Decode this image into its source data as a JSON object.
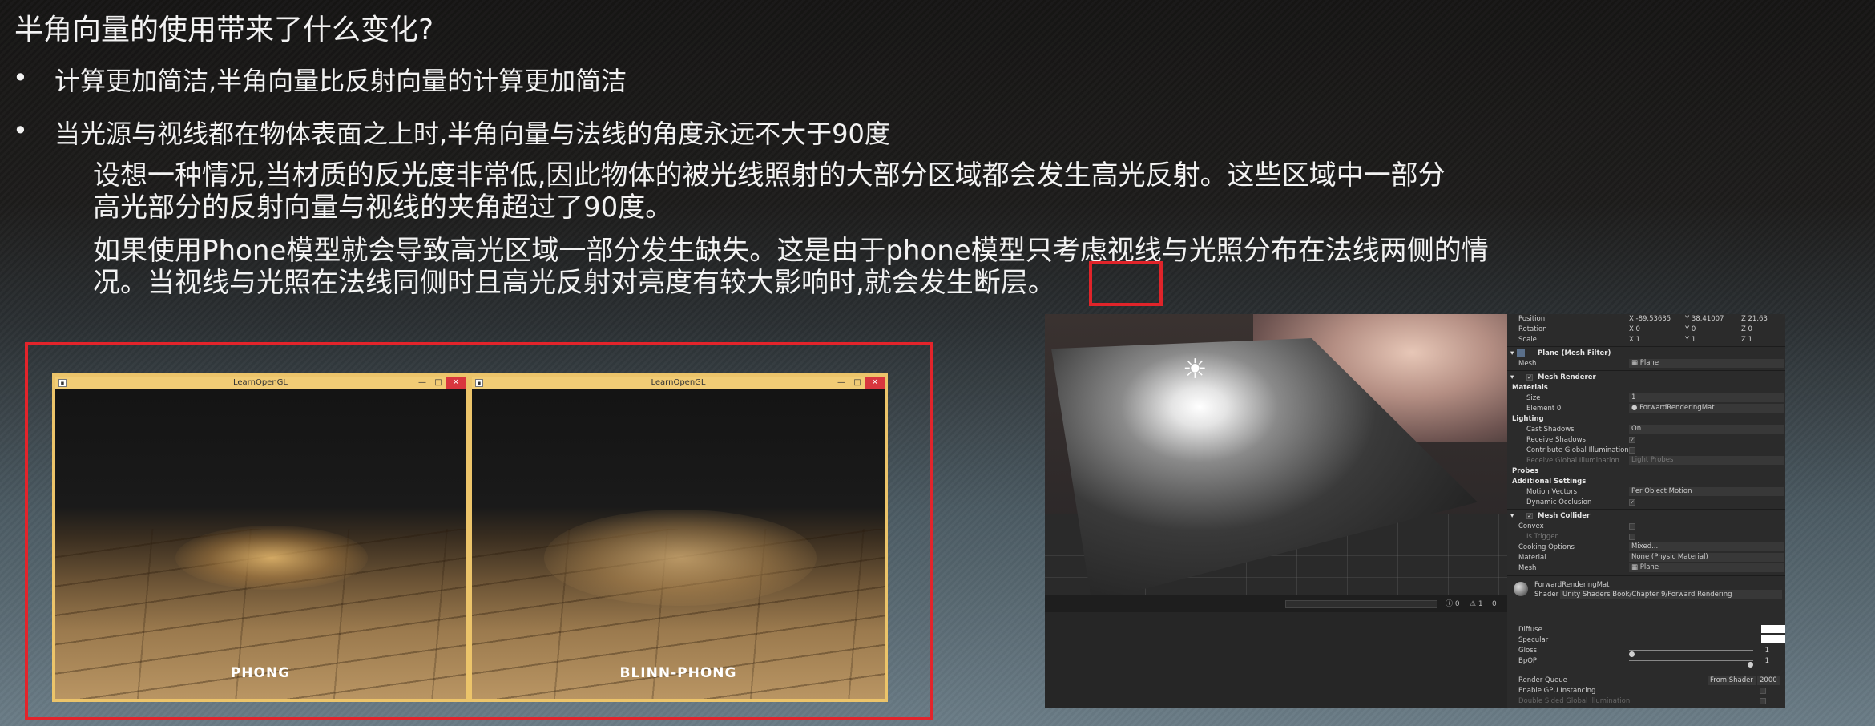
{
  "slide": {
    "title": "半角向量的使用带来了什么变化?",
    "bullets": [
      "计算更加简洁,半角向量比反射向量的计算更加简洁",
      "当光源与视线都在物体表面之上时,半角向量与法线的角度永远不大于90度"
    ],
    "bullet_mark": "•",
    "paragraphs": {
      "p1_line1": "设想一种情况,当材质的反光度非常低,因此物体的被光线照射的大部分区域都会发生高光反射。这些区域中一部分",
      "p1_line2": "高光部分的反射向量与视线的夹角超过了90度。",
      "p2_line1": "如果使用Phone模型就会导致高光区域一部分发生缺失。这是由于phone模型只考虑视线与光照分布在法线两侧的情",
      "p2_line2": "况。当视线与光照在法线同侧时且高光反射对亮度有较大影响时,就会发生断层。"
    },
    "accent_color": "#e3242b"
  },
  "comparison": {
    "windows": [
      {
        "title": "LearnOpenGL",
        "label": "PHONG"
      },
      {
        "title": "LearnOpenGL",
        "label": "BLINN-PHONG"
      }
    ],
    "controls": {
      "minimize": "—",
      "maximize": "□",
      "close": "✕"
    },
    "frame_color": "#ecc46a"
  },
  "editor": {
    "statusbar": {
      "warn": "⚠ 1",
      "info": "ⓘ 0",
      "err": "0"
    },
    "inspector": {
      "transform": [
        {
          "label": "Position",
          "x": "X -89.53635",
          "y": "Y 38.41007",
          "z": "Z 21.63"
        },
        {
          "label": "Rotation",
          "x": "X 0",
          "y": "Y 0",
          "z": "Z 0"
        },
        {
          "label": "Scale",
          "x": "X 1",
          "y": "Y 1",
          "z": "Z 1"
        }
      ],
      "mesh_filter": {
        "header": "Plane (Mesh Filter)",
        "mesh_label": "Mesh",
        "mesh_value": "▦ Plane"
      },
      "mesh_renderer": {
        "header": "Mesh Renderer",
        "materials": "Materials",
        "size_label": "Size",
        "size_value": "1",
        "element_label": "Element 0",
        "element_value": "● ForwardRenderingMat",
        "lighting": "Lighting",
        "cast_label": "Cast Shadows",
        "cast_value": "On",
        "receive_label": "Receive Shadows",
        "contrib_label": "Contribute Global Illumination",
        "rgi_label": "Receive Global Illumination",
        "rgi_value": "Light Probes",
        "probes": "Probes",
        "additional": "Additional Settings",
        "motion_label": "Motion Vectors",
        "motion_value": "Per Object Motion",
        "dyn_label": "Dynamic Occlusion"
      },
      "mesh_collider": {
        "header": "Mesh Collider",
        "convex": "Convex",
        "trigger": "Is Trigger",
        "cooking_label": "Cooking Options",
        "cooking_value": "Mixed...",
        "material_label": "Material",
        "material_value": "None (Physic Material)",
        "mesh_label": "Mesh",
        "mesh_value": "▦ Plane"
      },
      "material": {
        "name": "ForwardRenderingMat",
        "shader_label": "Shader",
        "shader_value": "Unity Shaders Book/Chapter 9/Forward Rendering",
        "diffuse": "Diffuse",
        "specular": "Specular",
        "gloss": "Gloss",
        "gloss_value": "1",
        "bpop": "BpOP",
        "bpop_value": "1",
        "gloss_fraction": 0.0,
        "bpop_fraction": 1.0
      },
      "render_queue_label": "Render Queue",
      "render_queue_mode": "From Shader",
      "render_queue_value": "2000",
      "gpu_instancing": "Enable GPU Instancing",
      "double_sided": "Double Sided Global Illumination"
    }
  }
}
